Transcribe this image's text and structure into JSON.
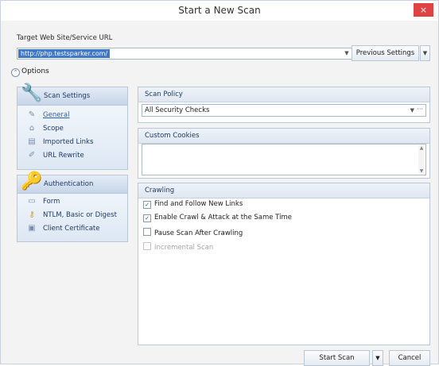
{
  "window": {
    "title": "Start a New Scan",
    "close_symbol": "×"
  },
  "target": {
    "label": "Target Web Site/Service URL",
    "url_value": "http://php.testsparker.com/",
    "previous_settings_label": "Previous Settings"
  },
  "options": {
    "toggle_label": "Options"
  },
  "scan_settings": {
    "header": "Scan Settings",
    "items": [
      {
        "label": "General",
        "icon": "wrench-icon"
      },
      {
        "label": "Scope",
        "icon": "scope-icon"
      },
      {
        "label": "Imported Links",
        "icon": "links-icon"
      },
      {
        "label": "URL Rewrite",
        "icon": "rewrite-icon"
      }
    ]
  },
  "authentication": {
    "header": "Authentication",
    "items": [
      {
        "label": "Form",
        "icon": "form-icon"
      },
      {
        "label": "NTLM, Basic or Digest",
        "icon": "key-icon"
      },
      {
        "label": "Client Certificate",
        "icon": "certificate-icon"
      }
    ]
  },
  "scan_policy": {
    "header": "Scan Policy",
    "value": "All Security Checks",
    "more": "···"
  },
  "custom_cookies": {
    "header": "Custom Cookies"
  },
  "crawling": {
    "header": "Crawling",
    "options": [
      {
        "label": "Find and Follow New Links",
        "checked": true,
        "enabled": true
      },
      {
        "label": "Enable Crawl & Attack at the Same Time",
        "checked": true,
        "enabled": true
      },
      {
        "label": "Pause Scan After Crawling",
        "checked": false,
        "enabled": true
      },
      {
        "label": "Incremental Scan",
        "checked": false,
        "enabled": false
      }
    ]
  },
  "footer": {
    "start_label": "Start Scan",
    "cancel_label": "Cancel"
  }
}
